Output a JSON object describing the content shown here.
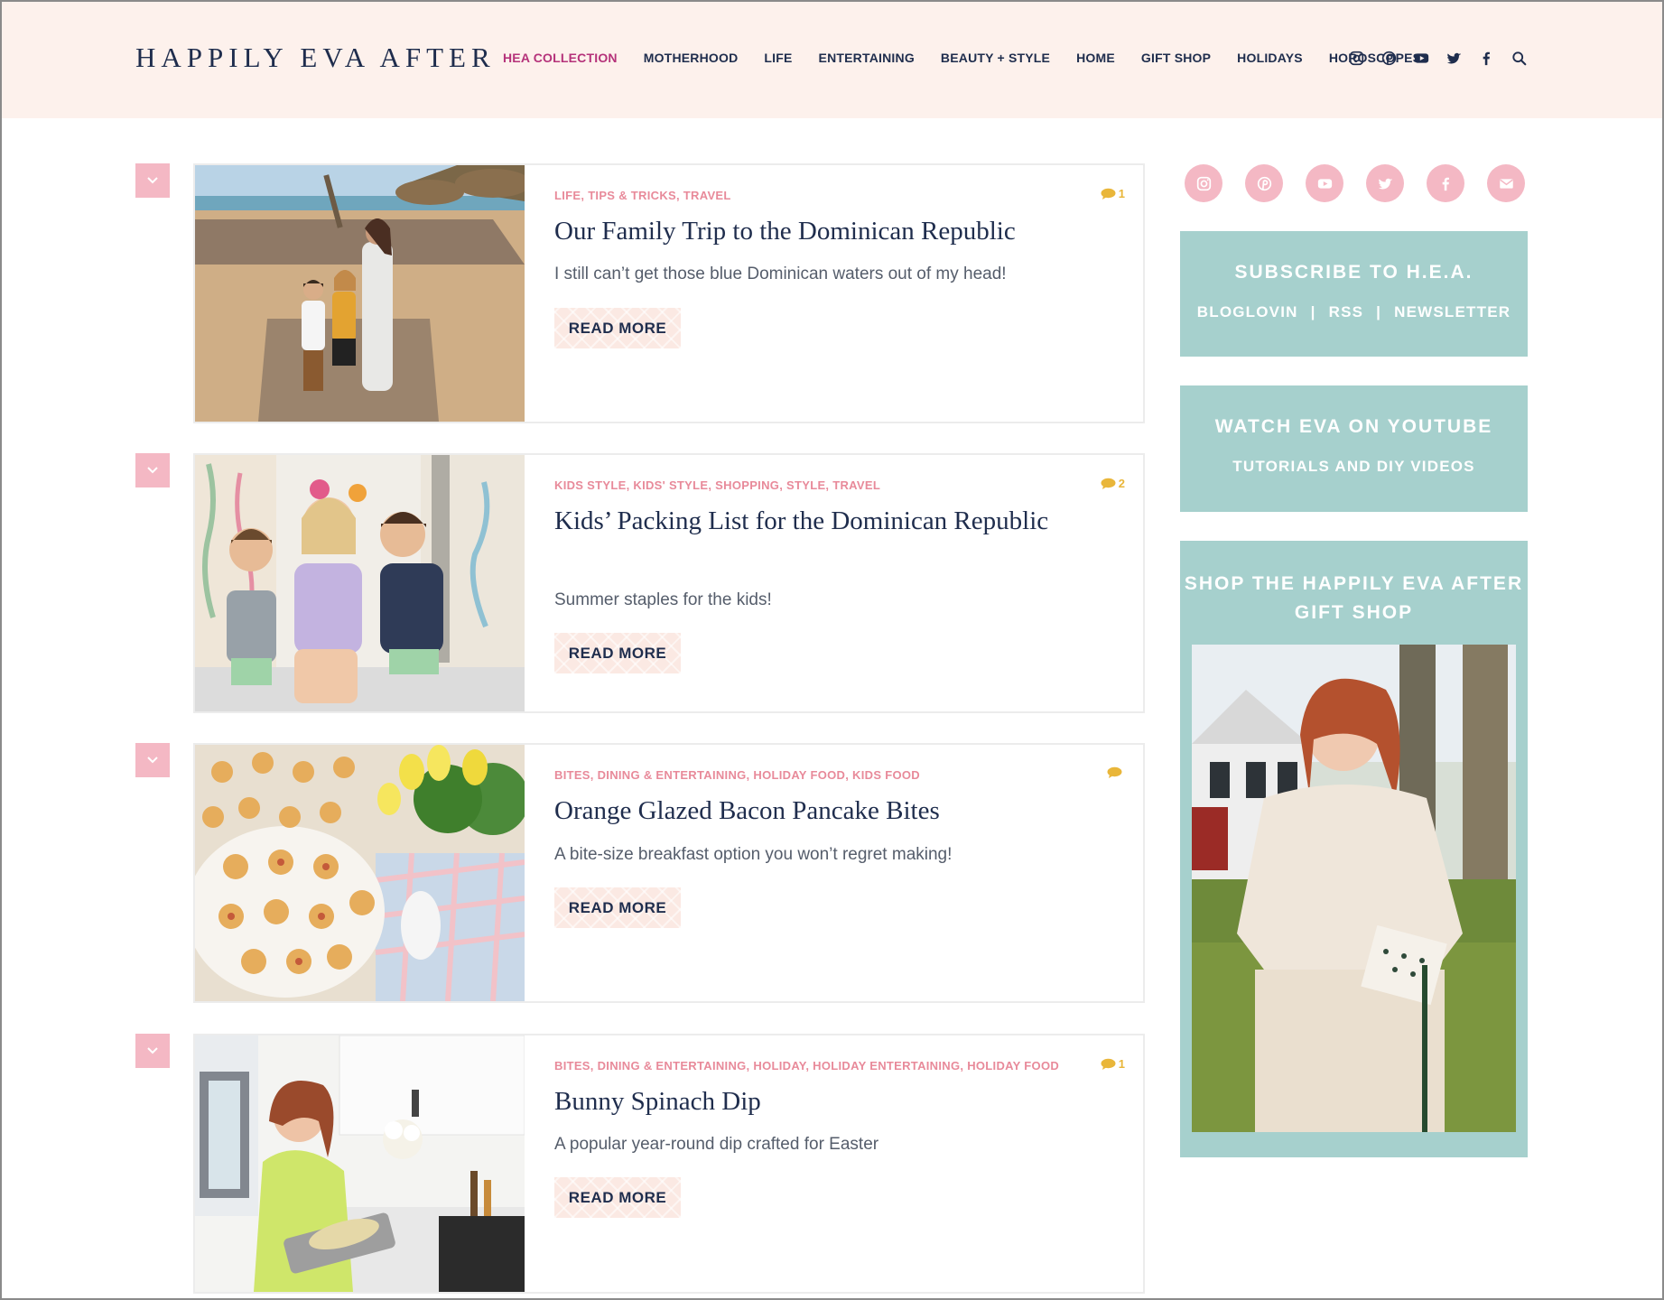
{
  "site": {
    "logo": "HAPPILY EVA AFTER"
  },
  "nav": {
    "items": [
      {
        "label": "HEA COLLECTION",
        "active": true
      },
      {
        "label": "MOTHERHOOD"
      },
      {
        "label": "LIFE"
      },
      {
        "label": "ENTERTAINING"
      },
      {
        "label": "BEAUTY + STYLE"
      },
      {
        "label": "HOME"
      },
      {
        "label": "GIFT SHOP"
      },
      {
        "label": "HOLIDAYS"
      },
      {
        "label": "HOROSCOPES"
      }
    ],
    "icons": [
      "instagram-icon",
      "pinterest-icon",
      "youtube-icon",
      "twitter-icon",
      "facebook-icon",
      "search-icon"
    ]
  },
  "posts": [
    {
      "categories": "LIFE, TIPS & TRICKS, TRAVEL",
      "comments": "1",
      "title": "Our Family Trip to the Dominican Republic",
      "excerpt": "I still can’t get those blue Dominican waters out of my head!",
      "read_more": "READ MORE"
    },
    {
      "categories": "KIDS STYLE, KIDS' STYLE, SHOPPING, STYLE, TRAVEL",
      "comments": "2",
      "title": "Kids’ Packing List for the Dominican Republic",
      "excerpt": "Summer staples for the kids!",
      "read_more": "READ MORE"
    },
    {
      "categories": "BITES, DINING & ENTERTAINING, HOLIDAY FOOD, KIDS FOOD",
      "comments": "",
      "title": "Orange Glazed Bacon Pancake Bites",
      "excerpt": "A bite-size breakfast option you won’t regret making!",
      "read_more": "READ MORE"
    },
    {
      "categories": "BITES, DINING & ENTERTAINING, HOLIDAY, HOLIDAY ENTERTAINING, HOLIDAY FOOD",
      "comments": "1",
      "title": "Bunny Spinach Dip",
      "excerpt": "A popular year-round dip crafted for Easter",
      "read_more": "READ MORE"
    }
  ],
  "sidebar": {
    "social_icons": [
      "instagram-icon",
      "pinterest-icon",
      "youtube-icon",
      "twitter-icon",
      "facebook-icon",
      "email-icon"
    ],
    "subscribe": {
      "heading": "SUBSCRIBE TO H.E.A.",
      "links": [
        "BLOGLOVIN",
        "RSS",
        "NEWSLETTER"
      ],
      "separator": "|"
    },
    "youtube": {
      "heading": "WATCH EVA ON YOUTUBE",
      "sub": "TUTORIALS AND DIY VIDEOS"
    },
    "shop": {
      "heading_line1": "SHOP THE HAPPILY EVA AFTER",
      "heading_line2": "GIFT SHOP"
    }
  },
  "colors": {
    "header_bg": "#fdf1ec",
    "navy": "#1f2d4d",
    "active_nav": "#b5327a",
    "pink": "#f4b8c4",
    "category": "#e88a9a",
    "comment": "#e9b63a",
    "teal": "#a6d0cd"
  }
}
